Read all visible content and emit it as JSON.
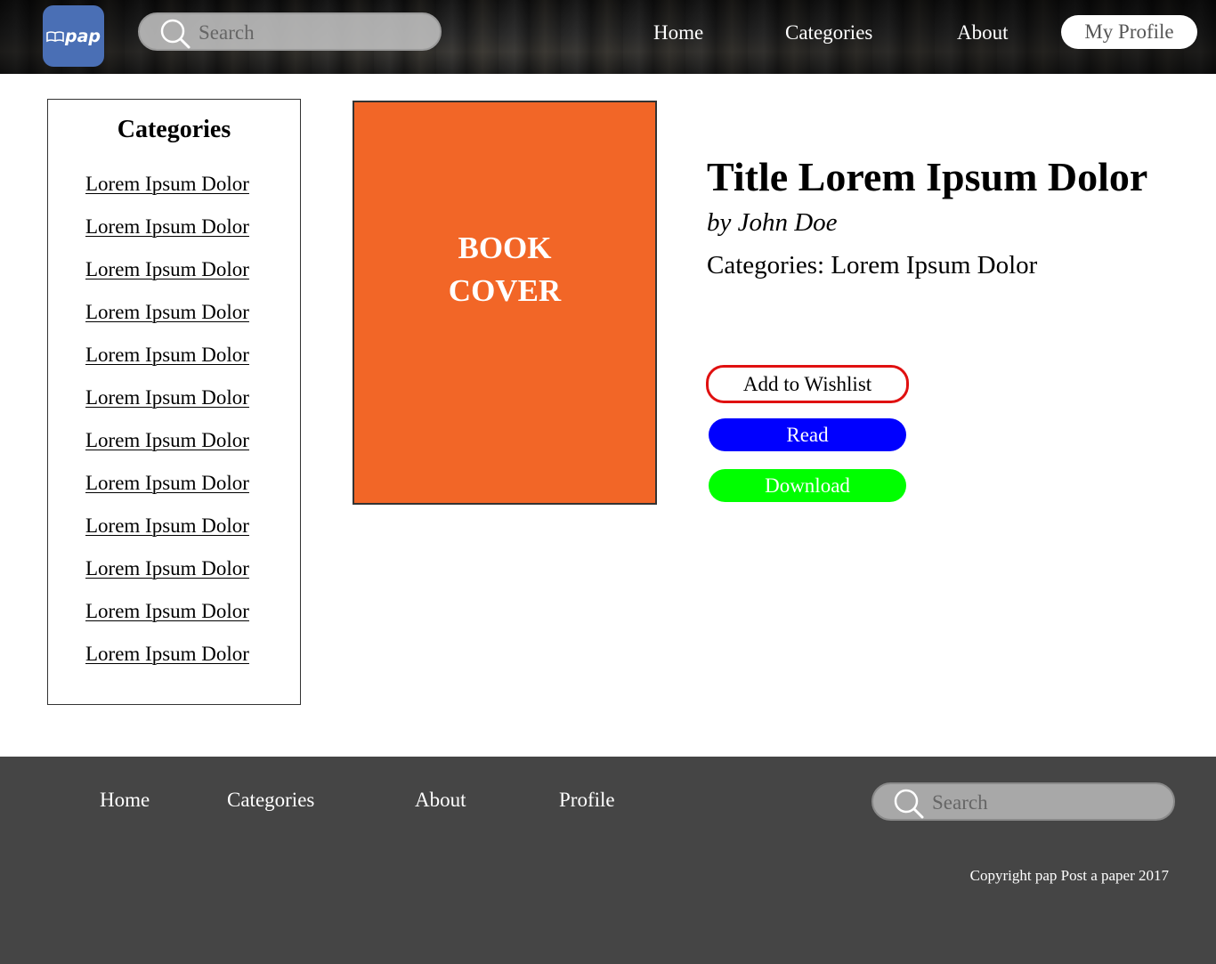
{
  "header": {
    "logo_text": "pap",
    "search_placeholder": "Search",
    "nav": [
      "Home",
      "Categories",
      "About"
    ],
    "profile_label": "My Profile"
  },
  "sidebar": {
    "title": "Categories",
    "items": [
      "Lorem Ipsum Dolor",
      "Lorem Ipsum Dolor",
      "Lorem Ipsum Dolor",
      "Lorem Ipsum Dolor",
      "Lorem Ipsum Dolor",
      "Lorem Ipsum Dolor",
      "Lorem Ipsum Dolor",
      "Lorem Ipsum Dolor",
      "Lorem Ipsum Dolor",
      "Lorem Ipsum Dolor",
      "Lorem Ipsum Dolor",
      "Lorem Ipsum Dolor"
    ]
  },
  "book": {
    "cover_line1": "BOOK",
    "cover_line2": "COVER",
    "title": "Title Lorem Ipsum Dolor",
    "author": "by John Doe",
    "categories": "Categories: Lorem Ipsum Dolor",
    "wishlist_label": "Add to Wishlist",
    "read_label": "Read",
    "download_label": "Download"
  },
  "footer": {
    "nav": [
      "Home",
      "Categories",
      "About",
      "Profile"
    ],
    "search_placeholder": "Search",
    "copyright": "Copyright pap Post a paper 2017"
  },
  "colors": {
    "logo_bg": "#4a6fb5",
    "cover_bg": "#f26627",
    "wishlist_border": "#e01010",
    "read_bg": "#0000ff",
    "download_bg": "#00ff00",
    "footer_bg": "#454545"
  }
}
